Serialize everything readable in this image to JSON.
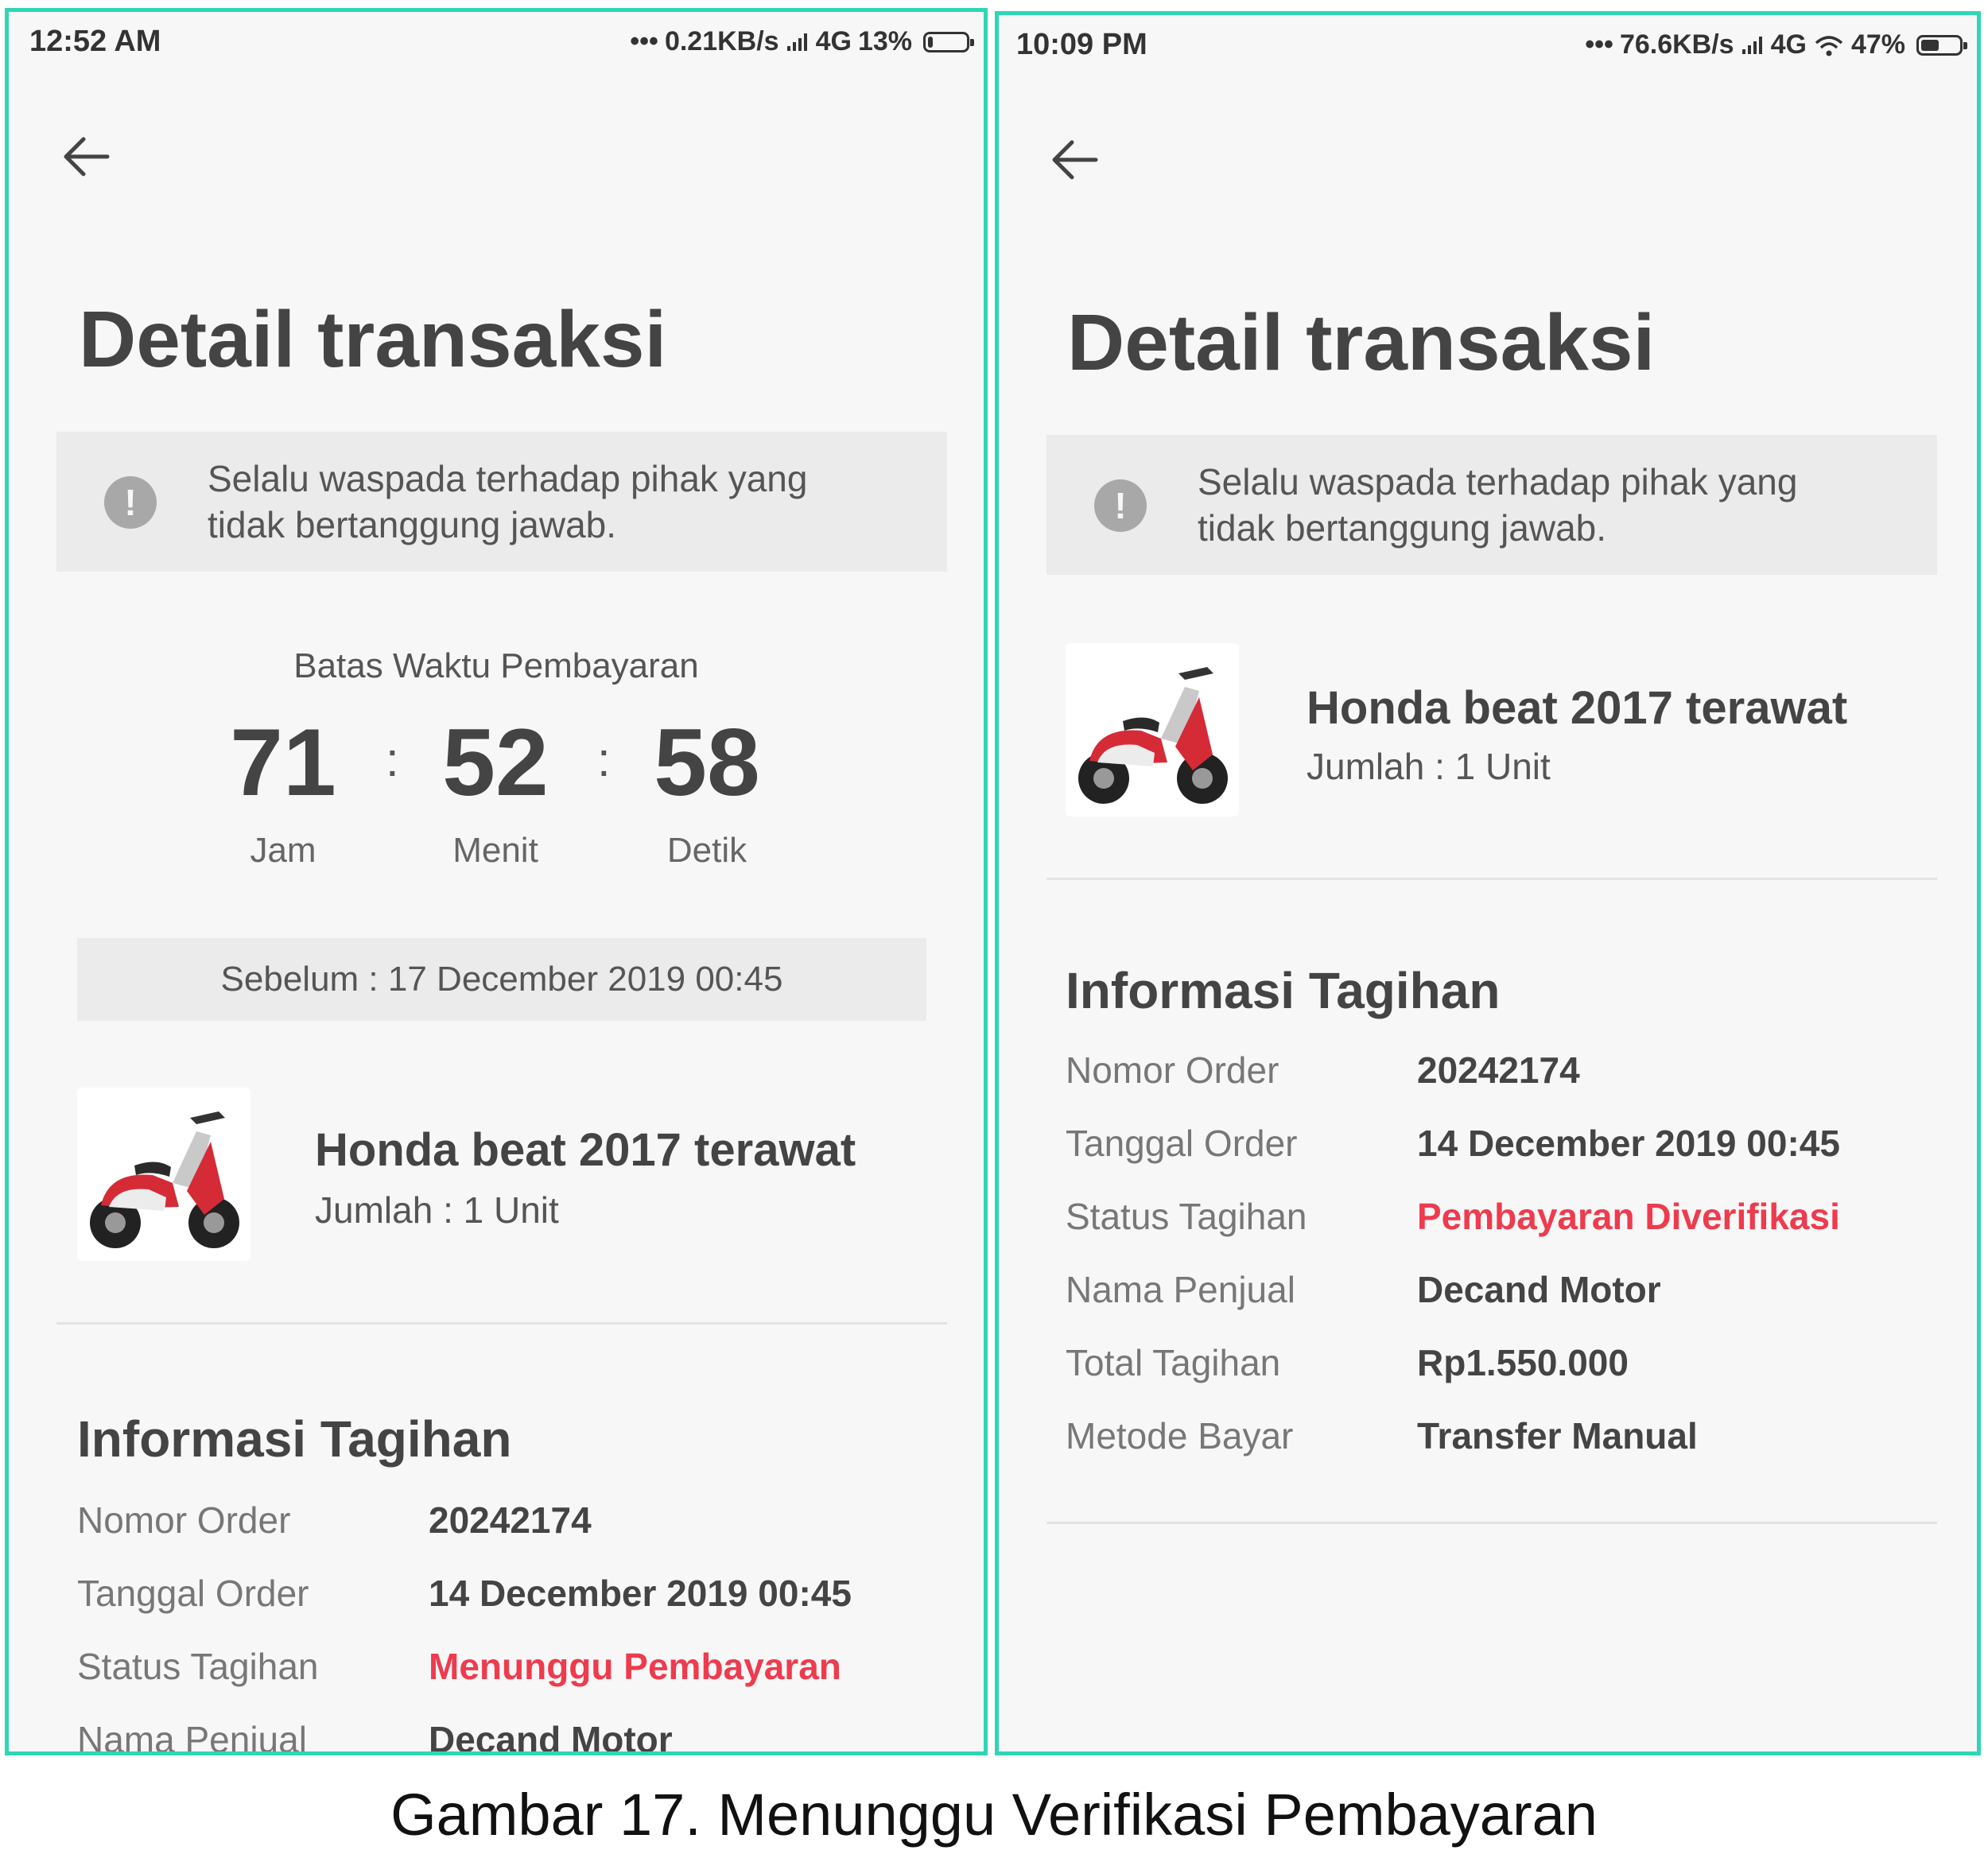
{
  "left": {
    "status_bar": {
      "time": "12:52 AM",
      "dots": "•••",
      "net_speed": "0.21KB/s",
      "signal": "4G",
      "battery_label": "13%",
      "battery_level": 0.13
    },
    "title": "Detail transaksi",
    "warning": {
      "text": "Selalu waspada terhadap pihak yang tidak bertanggung jawab."
    },
    "countdown": {
      "label": "Batas Waktu Pembayaran",
      "hours": "71",
      "minutes": "52",
      "seconds": "58",
      "hours_unit": "Jam",
      "minutes_unit": "Menit",
      "seconds_unit": "Detik",
      "separator": ":"
    },
    "deadline": "Sebelum : 17 December 2019 00:45",
    "product": {
      "name": "Honda beat 2017 terawat",
      "quantity": "Jumlah : 1 Unit"
    },
    "billing": {
      "title": "Informasi Tagihan",
      "rows": [
        {
          "label": "Nomor Order",
          "value": "20242174"
        },
        {
          "label": "Tanggal Order",
          "value": "14 December 2019 00:45"
        },
        {
          "label": "Status Tagihan",
          "value": "Menunggu Pembayaran"
        },
        {
          "label": "Nama Penjual",
          "value": "Decand Motor"
        }
      ]
    }
  },
  "right": {
    "status_bar": {
      "time": "10:09 PM",
      "dots": "•••",
      "net_speed": "76.6KB/s",
      "signal": "4G",
      "battery_label": "47%",
      "battery_level": 0.47
    },
    "title": "Detail transaksi",
    "warning": {
      "text": "Selalu waspada terhadap pihak yang tidak bertanggung jawab."
    },
    "product": {
      "name": "Honda beat 2017 terawat",
      "quantity": "Jumlah : 1 Unit"
    },
    "billing": {
      "title": "Informasi Tagihan",
      "rows": [
        {
          "label": "Nomor Order",
          "value": "20242174"
        },
        {
          "label": "Tanggal Order",
          "value": "14 December 2019 00:45"
        },
        {
          "label": "Status Tagihan",
          "value": "Pembayaran Diverifikasi"
        },
        {
          "label": "Nama Penjual",
          "value": "Decand Motor"
        },
        {
          "label": "Total Tagihan",
          "value": "Rp1.550.000"
        },
        {
          "label": "Metode Bayar",
          "value": "Transfer Manual"
        }
      ]
    }
  },
  "caption": "Gambar 17.  Menunggu Verifikasi Pembayaran",
  "colors": {
    "frame": "#2fd6b4",
    "status_red": "#ee3b4d",
    "bg": "#f7f7f7"
  }
}
